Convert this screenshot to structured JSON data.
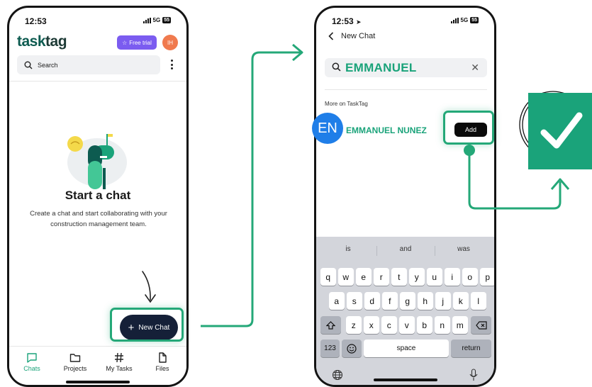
{
  "left_phone": {
    "status": {
      "time": "12:53",
      "network": "5G",
      "battery": "55"
    },
    "brand": {
      "part1": "task",
      "part2": "tag"
    },
    "free_trial_label": "Free trial",
    "avatar_initials": "IH",
    "search_placeholder": "Search",
    "empty_state": {
      "title": "Start a chat",
      "description": "Create a chat and start collaborating with your construction management team."
    },
    "new_chat_label": "New Chat",
    "tabs": [
      {
        "label": "Chats",
        "icon": "chat-bubble-icon",
        "active": true
      },
      {
        "label": "Projects",
        "icon": "folder-icon",
        "active": false
      },
      {
        "label": "My Tasks",
        "icon": "hash-icon",
        "active": false
      },
      {
        "label": "Files",
        "icon": "file-icon",
        "active": false
      }
    ]
  },
  "right_phone": {
    "status": {
      "time": "12:53",
      "network": "5G",
      "battery": "55"
    },
    "header_title": "New Chat",
    "search_value": "EMMANUEL",
    "section_label": "More on TaskTag",
    "contact": {
      "initials": "EN",
      "name": "EMMANUEL NUNEZ"
    },
    "add_label": "Add",
    "keyboard": {
      "suggestions": [
        "is",
        "and",
        "was"
      ],
      "row1": [
        "q",
        "w",
        "e",
        "r",
        "t",
        "y",
        "u",
        "i",
        "o",
        "p"
      ],
      "row2": [
        "a",
        "s",
        "d",
        "f",
        "g",
        "h",
        "j",
        "k",
        "l"
      ],
      "row3": [
        "z",
        "x",
        "c",
        "v",
        "b",
        "n",
        "m"
      ],
      "numbers_label": "123",
      "space_label": "space",
      "return_label": "return"
    }
  },
  "colors": {
    "accent_green": "#1aa37a",
    "highlight_green": "#24a878",
    "brand_teal": "#0d5b50",
    "new_chat_button": "#152038",
    "free_trial_purple": "#7b5cf0",
    "avatar_orange": "#f07a4e",
    "contact_avatar_blue": "#1f7ee8",
    "keyboard_bg": "#d3d5db"
  }
}
